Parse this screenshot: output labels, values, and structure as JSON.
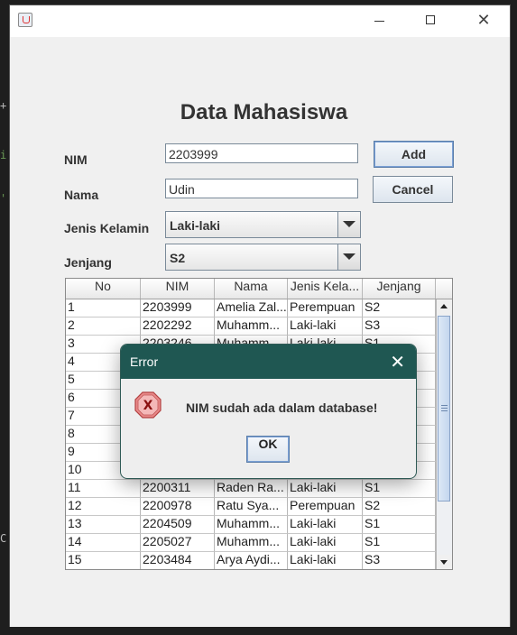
{
  "window": {
    "minimize_glyph": "",
    "maximize_glyph": "",
    "close_glyph": "✕"
  },
  "form": {
    "title": "Data Mahasiswa",
    "nim_label": "NIM",
    "nim_value": "2203999",
    "nama_label": "Nama",
    "nama_value": "Udin",
    "jk_label": "Jenis Kelamin",
    "jk_value": "Laki-laki",
    "jenjang_label": "Jenjang",
    "jenjang_value": "S2",
    "add_label": "Add",
    "cancel_label": "Cancel"
  },
  "table": {
    "columns": [
      "No",
      "NIM",
      "Nama",
      "Jenis Kela...",
      "Jenjang"
    ],
    "rows": [
      [
        "1",
        "2203999",
        "Amelia Zal...",
        "Perempuan",
        "S2"
      ],
      [
        "2",
        "2202292",
        "Muhamm...",
        "Laki-laki",
        "S3"
      ],
      [
        "3",
        "2203246",
        "Muhamm...",
        "Laki-laki",
        "S1"
      ],
      [
        "4",
        "",
        "",
        "",
        ""
      ],
      [
        "5",
        "",
        "",
        "",
        ""
      ],
      [
        "6",
        "",
        "",
        "",
        ""
      ],
      [
        "7",
        "",
        "",
        "",
        ""
      ],
      [
        "8",
        "",
        "",
        "",
        ""
      ],
      [
        "9",
        "",
        "",
        "",
        ""
      ],
      [
        "10",
        "",
        "",
        "",
        ""
      ],
      [
        "11",
        "2200311",
        "Raden Ra...",
        "Laki-laki",
        "S1"
      ],
      [
        "12",
        "2200978",
        "Ratu Sya...",
        "Perempuan",
        "S2"
      ],
      [
        "13",
        "2204509",
        "Muhamm...",
        "Laki-laki",
        "S1"
      ],
      [
        "14",
        "2205027",
        "Muhamm...",
        "Laki-laki",
        "S1"
      ],
      [
        "15",
        "2203484",
        "Arya Aydi...",
        "Laki-laki",
        "S3"
      ]
    ]
  },
  "dialog": {
    "title": "Error",
    "close_glyph": "✕",
    "message": "NIM sudah ada dalam database!",
    "ok_label": "OK",
    "icon_glyph": "X"
  },
  "background": {
    "glyph_plus": "+",
    "glyph_i": "i",
    "glyph_tick": "'",
    "glyph_c": "C"
  }
}
